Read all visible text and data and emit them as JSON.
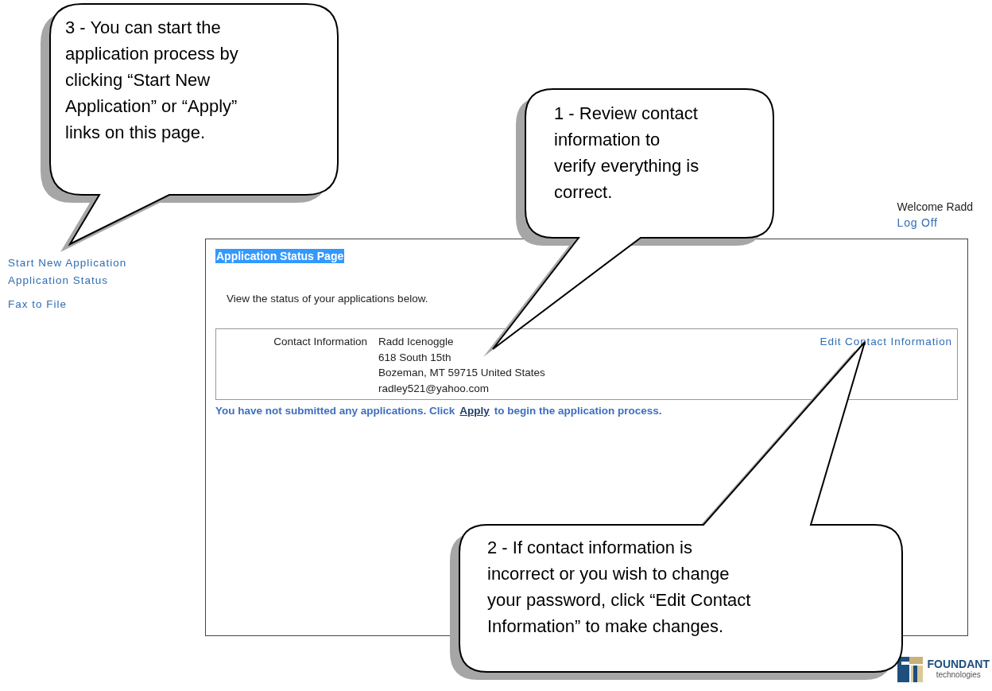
{
  "user": {
    "greeting": "Welcome Radd",
    "logoff": "Log Off"
  },
  "sidebar": {
    "groups": [
      {
        "items": [
          {
            "label": "Start New Application"
          },
          {
            "label": "Application Status"
          }
        ]
      },
      {
        "items": [
          {
            "label": "Fax to File"
          }
        ]
      }
    ]
  },
  "panel": {
    "title": "Application Status Page",
    "intro": "View the status of your applications below.",
    "contact": {
      "label": "Contact Information",
      "lines": [
        "Radd Icenoggle",
        "618 South 15th",
        "Bozeman, MT 59715 United States",
        "radley521@yahoo.com"
      ],
      "edit_link": "Edit Contact Information"
    },
    "message": {
      "before": "You have not submitted any applications. Click",
      "link": "Apply",
      "after": "to begin the application process."
    }
  },
  "footer": {
    "logo_name": "FOUNDANT",
    "logo_tagline": "technologies"
  },
  "callouts": [
    {
      "text": "3 - You can start the\napplication process by\nclicking “Start New\nApplication” or “Apply”\nlinks on this page."
    },
    {
      "text": "1 - Review contact\ninformation to\nverify everything is\ncorrect."
    },
    {
      "text": "2 - If contact information is\nincorrect or you wish to change\nyour password, click “Edit Contact\nInformation” to make changes."
    }
  ]
}
